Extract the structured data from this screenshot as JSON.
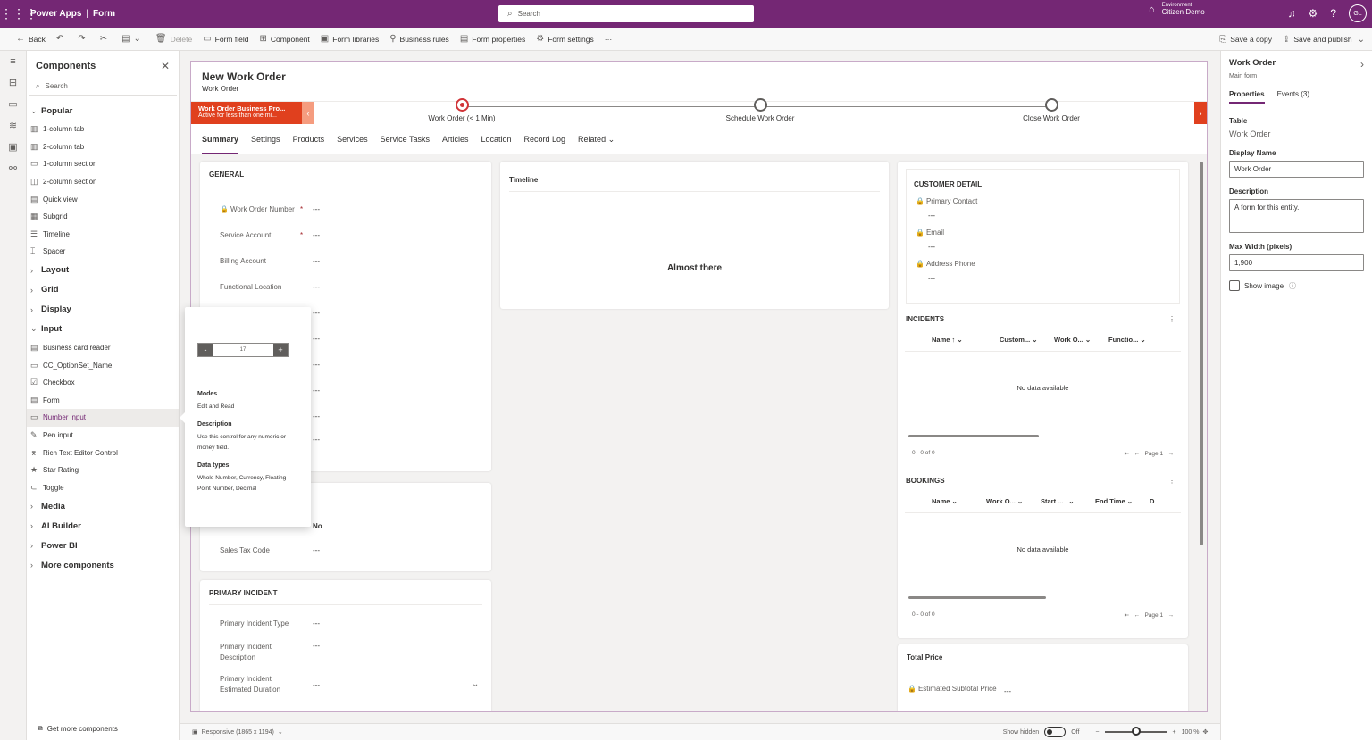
{
  "topbar": {
    "app": "Power Apps",
    "section": "Form",
    "search_placeholder": "Search",
    "env_label": "Environment",
    "env_name": "Citizen Demo",
    "avatar": "GL"
  },
  "cmdbar": {
    "back": "Back",
    "delete": "Delete",
    "form_field": "Form field",
    "component": "Component",
    "form_libraries": "Form libraries",
    "business_rules": "Business rules",
    "form_properties": "Form properties",
    "form_settings": "Form settings",
    "more": "···",
    "save_copy": "Save a copy",
    "save_publish": "Save and publish"
  },
  "components": {
    "title": "Components",
    "search_placeholder": "Search",
    "popular": "Popular",
    "popular_items": [
      "1-column tab",
      "2-column tab",
      "1-column section",
      "2-column section",
      "Quick view",
      "Subgrid",
      "Timeline",
      "Spacer"
    ],
    "layout": "Layout",
    "grid": "Grid",
    "display": "Display",
    "input": "Input",
    "input_items": [
      "Business card reader",
      "CC_OptionSet_Name",
      "Checkbox",
      "Form",
      "Number input",
      "Pen input",
      "Rich Text Editor Control",
      "Star Rating",
      "Toggle"
    ],
    "media": "Media",
    "ai_builder": "AI Builder",
    "power_bi": "Power BI",
    "more_components": "More components",
    "get_more": "Get more components"
  },
  "form": {
    "title": "New Work Order",
    "subtitle": "Work Order",
    "bpf_name": "Work Order Business Pro...",
    "bpf_status": "Active for less than one mi...",
    "stage1": "Work Order  (< 1 Min)",
    "stage2": "Schedule Work Order",
    "stage3": "Close Work Order",
    "tabs": [
      "Summary",
      "Settings",
      "Products",
      "Services",
      "Service Tasks",
      "Articles",
      "Location",
      "Record Log",
      "Related"
    ],
    "general": "GENERAL",
    "f_won": "Work Order Number",
    "f_sa": "Service Account",
    "f_ba": "Billing Account",
    "f_fl": "Functional Location",
    "dash": "---",
    "taxable_val": "No",
    "f_stc": "Sales Tax Code",
    "primary_incident": "PRIMARY INCIDENT",
    "f_pit": "Primary Incident Type",
    "f_pid": "Primary Incident Description",
    "f_pied": "Primary Incident Estimated Duration",
    "timeline": "Timeline",
    "almost": "Almost there",
    "customer_detail": "CUSTOMER DETAIL",
    "f_pc": "Primary Contact",
    "f_email": "Email",
    "f_ap": "Address Phone",
    "incidents": "INCIDENTS",
    "inc_cols": [
      "Name ↑",
      "Custom...",
      "Work O...",
      "Functio..."
    ],
    "no_data": "No data available",
    "count": "0 - 0 of 0",
    "page": "Page 1",
    "bookings": "BOOKINGS",
    "book_cols": [
      "Name",
      "Work O...",
      "Start ...",
      "End Time",
      "D"
    ],
    "total_price": "Total Price",
    "f_esp": "Estimated Subtotal Price"
  },
  "tooltip": {
    "stepper_value": "17",
    "minus": "-",
    "plus": "+",
    "modes_h": "Modes",
    "modes": "Edit and Read",
    "desc_h": "Description",
    "desc": "Use this control for any numeric or money field.",
    "types_h": "Data types",
    "types": "Whole Number, Currency, Floating Point Number, Decimal"
  },
  "props": {
    "title": "Work Order",
    "subtitle": "Main form",
    "tab_properties": "Properties",
    "tab_events": "Events (3)",
    "table_l": "Table",
    "table_v": "Work Order",
    "display_l": "Display Name",
    "display_v": "Work Order",
    "desc_l": "Description",
    "desc_v": "A form for this entity.",
    "maxw_l": "Max Width (pixels)",
    "maxw_v": "1,900",
    "show_image": "Show image"
  },
  "status": {
    "responsive": "Responsive (1865 x 1194)",
    "show_hidden": "Show hidden",
    "off": "Off",
    "zoom": "100 %",
    "zoom_level": 100
  }
}
